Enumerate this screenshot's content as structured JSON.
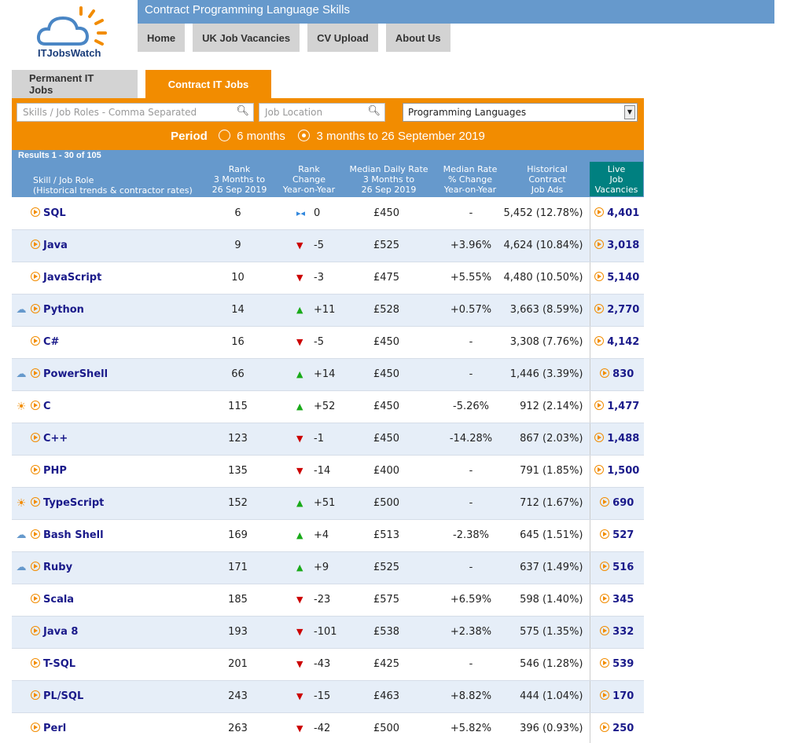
{
  "site": {
    "logo_text": "ITJobsWatch",
    "page_title": "Contract Programming Language Skills"
  },
  "nav": [
    "Home",
    "UK Job Vacancies",
    "CV Upload",
    "About Us"
  ],
  "tabs": [
    {
      "label": "Permanent IT Jobs",
      "active": false
    },
    {
      "label": "Contract IT Jobs",
      "active": true
    }
  ],
  "search": {
    "skills_placeholder": "Skills / Job Roles - Comma Separated",
    "location_placeholder": "Job Location",
    "category_selected": "Programming Languages"
  },
  "period": {
    "label": "Period",
    "option1": "6 months",
    "option2": "3 months to 26 September 2019",
    "selected": "option2"
  },
  "results": {
    "count_text": "Results 1 - 30 of 105"
  },
  "headers": {
    "skill": [
      "Skill / Job Role",
      "(Historical trends & contractor rates)"
    ],
    "rank": [
      "Rank",
      "3 Months to",
      "26 Sep 2019"
    ],
    "rank_change": [
      "Rank",
      "Change",
      "Year-on-Year"
    ],
    "median": [
      "Median Daily Rate",
      "3 Months to",
      "26 Sep 2019"
    ],
    "median_change": [
      "Median Rate",
      "% Change",
      "Year-on-Year"
    ],
    "historical": [
      "Historical",
      "Contract",
      "Job Ads"
    ],
    "live": [
      "Live",
      "Job",
      "Vacancies"
    ]
  },
  "colors": {
    "accent": "#f28c00",
    "header_blue": "#6699cc",
    "live_teal": "#008080",
    "link": "#1a1a8a"
  },
  "rows": [
    {
      "icon": "",
      "skill": "SQL",
      "rank": "6",
      "dir": "same",
      "change": "0",
      "median": "£450",
      "pct": "-",
      "hist": "5,452 (12.78%)",
      "live": "4,401"
    },
    {
      "icon": "",
      "skill": "Java",
      "rank": "9",
      "dir": "down",
      "change": "-5",
      "median": "£525",
      "pct": "+3.96%",
      "hist": "4,624 (10.84%)",
      "live": "3,018"
    },
    {
      "icon": "",
      "skill": "JavaScript",
      "rank": "10",
      "dir": "down",
      "change": "-3",
      "median": "£475",
      "pct": "+5.55%",
      "hist": "4,480 (10.50%)",
      "live": "5,140"
    },
    {
      "icon": "cloud-sun",
      "skill": "Python",
      "rank": "14",
      "dir": "up",
      "change": "+11",
      "median": "£528",
      "pct": "+0.57%",
      "hist": "3,663 (8.59%)",
      "live": "2,770"
    },
    {
      "icon": "",
      "skill": "C#",
      "rank": "16",
      "dir": "down",
      "change": "-5",
      "median": "£450",
      "pct": "-",
      "hist": "3,308 (7.76%)",
      "live": "4,142"
    },
    {
      "icon": "cloud-sun",
      "skill": "PowerShell",
      "rank": "66",
      "dir": "up",
      "change": "+14",
      "median": "£450",
      "pct": "-",
      "hist": "1,446 (3.39%)",
      "live": "830"
    },
    {
      "icon": "sun",
      "skill": "C",
      "rank": "115",
      "dir": "up",
      "change": "+52",
      "median": "£450",
      "pct": "-5.26%",
      "hist": "912 (2.14%)",
      "live": "1,477"
    },
    {
      "icon": "",
      "skill": "C++",
      "rank": "123",
      "dir": "down",
      "change": "-1",
      "median": "£450",
      "pct": "-14.28%",
      "hist": "867 (2.03%)",
      "live": "1,488"
    },
    {
      "icon": "",
      "skill": "PHP",
      "rank": "135",
      "dir": "down",
      "change": "-14",
      "median": "£400",
      "pct": "-",
      "hist": "791 (1.85%)",
      "live": "1,500"
    },
    {
      "icon": "sun",
      "skill": "TypeScript",
      "rank": "152",
      "dir": "up",
      "change": "+51",
      "median": "£500",
      "pct": "-",
      "hist": "712 (1.67%)",
      "live": "690"
    },
    {
      "icon": "cloud-sun",
      "skill": "Bash Shell",
      "rank": "169",
      "dir": "up",
      "change": "+4",
      "median": "£513",
      "pct": "-2.38%",
      "hist": "645 (1.51%)",
      "live": "527"
    },
    {
      "icon": "cloud-sun",
      "skill": "Ruby",
      "rank": "171",
      "dir": "up",
      "change": "+9",
      "median": "£525",
      "pct": "-",
      "hist": "637 (1.49%)",
      "live": "516"
    },
    {
      "icon": "",
      "skill": "Scala",
      "rank": "185",
      "dir": "down",
      "change": "-23",
      "median": "£575",
      "pct": "+6.59%",
      "hist": "598 (1.40%)",
      "live": "345"
    },
    {
      "icon": "",
      "skill": "Java 8",
      "rank": "193",
      "dir": "down",
      "change": "-101",
      "median": "£538",
      "pct": "+2.38%",
      "hist": "575 (1.35%)",
      "live": "332"
    },
    {
      "icon": "",
      "skill": "T-SQL",
      "rank": "201",
      "dir": "down",
      "change": "-43",
      "median": "£425",
      "pct": "-",
      "hist": "546 (1.28%)",
      "live": "539"
    },
    {
      "icon": "",
      "skill": "PL/SQL",
      "rank": "243",
      "dir": "down",
      "change": "-15",
      "median": "£463",
      "pct": "+8.82%",
      "hist": "444 (1.04%)",
      "live": "170"
    },
    {
      "icon": "",
      "skill": "Perl",
      "rank": "263",
      "dir": "down",
      "change": "-42",
      "median": "£500",
      "pct": "+5.82%",
      "hist": "396 (0.93%)",
      "live": "250"
    }
  ]
}
